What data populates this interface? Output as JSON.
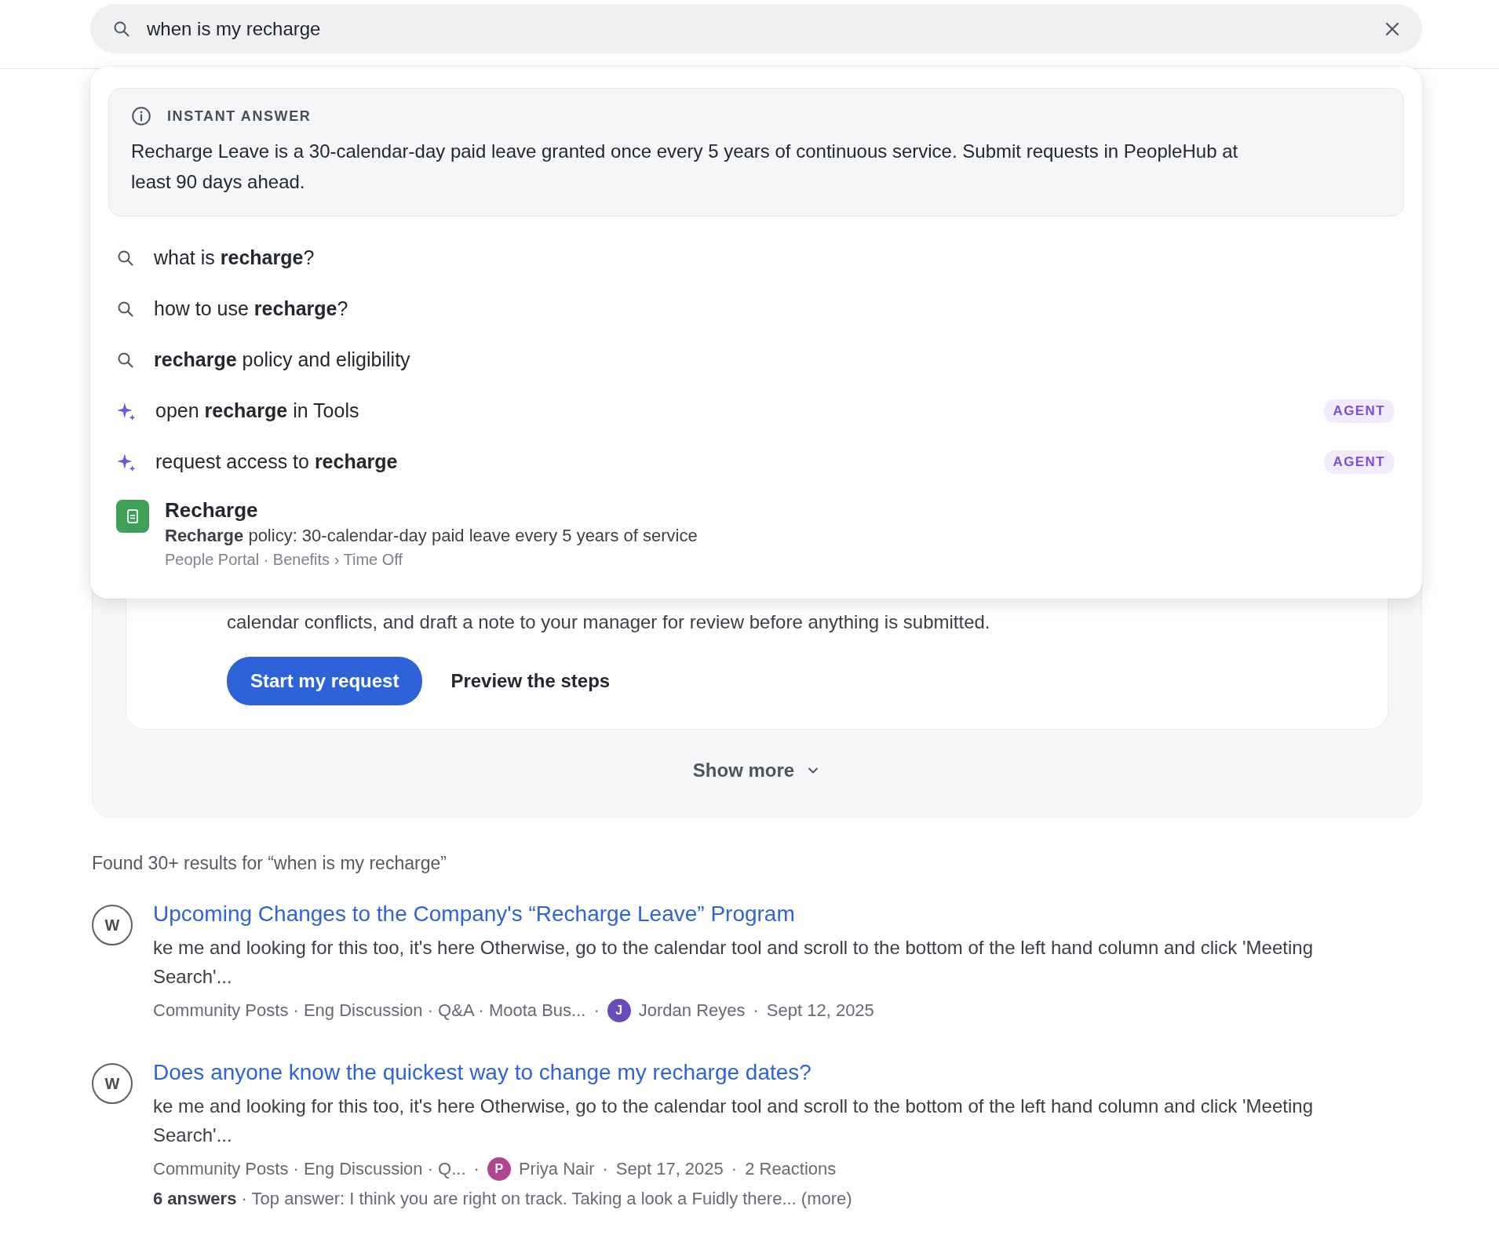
{
  "search": {
    "value": "when is my recharge"
  },
  "instant_answer": {
    "label": "INSTANT ANSWER",
    "text": "Recharge Leave is a 30-calendar-day paid leave granted once every 5 years of continuous service. Submit requests in PeopleHub at least 90 days ahead."
  },
  "suggestions": [
    {
      "kind": "search",
      "text": "what is **recharge**?"
    },
    {
      "kind": "search",
      "text": "how to use **recharge**?"
    },
    {
      "kind": "search",
      "text": "**recharge** policy and eligibility"
    },
    {
      "kind": "agent",
      "text": "open **recharge** in Tools",
      "badge": "AGENT"
    },
    {
      "kind": "agent",
      "text": "request access to **recharge**",
      "badge": "AGENT"
    }
  ],
  "top_result": {
    "title": "Recharge",
    "snippet": "**Recharge** policy: 30-calendar-day paid leave every 5 years of service",
    "path": "People Portal · Benefits › Time Off"
  },
  "agent_card": {
    "text": "calendar conflicts, and draft a note to your manager for review before anything is submitted.",
    "primary_button": "Start my request",
    "secondary_button": "Preview the steps"
  },
  "show_more": "Show more",
  "results_summary": "Found 30+ results for “when is my recharge”",
  "results": [
    {
      "source": "W",
      "title": "Upcoming Changes to the Company's “Recharge Leave” Program",
      "snippet": "ke me and looking for this too, it's here Otherwise, go to the calendar tool and scroll to the bottom of the left hand column and click 'Meeting Search'...",
      "meta": [
        "Community Posts · Eng Discussion · Q&A · Moota Bus...",
        "·"
      ],
      "author": {
        "initial": "J",
        "name": "Jordan Reyes",
        "color": "#6a4cb8"
      },
      "details": [
        "·",
        "Sept 12, 2025"
      ]
    },
    {
      "source": "W",
      "title": "Does anyone know the quickest way to change my recharge dates?",
      "snippet": "ke me and looking for this too, it's here Otherwise, go to the calendar tool and scroll to the bottom of the left hand column and click 'Meeting Search'...",
      "meta": [
        "Community Posts · Eng Discussion · Q...",
        "·"
      ],
      "author": {
        "initial": "P",
        "name": "Priya Nair",
        "color": "#b2458f"
      },
      "details": [
        "·",
        "Sept 17, 2025",
        "·",
        "2 Reactions"
      ],
      "answers": "**6 answers** · Top answer: I think you are right on track. Taking a look a Fuidly there... (more)"
    }
  ]
}
